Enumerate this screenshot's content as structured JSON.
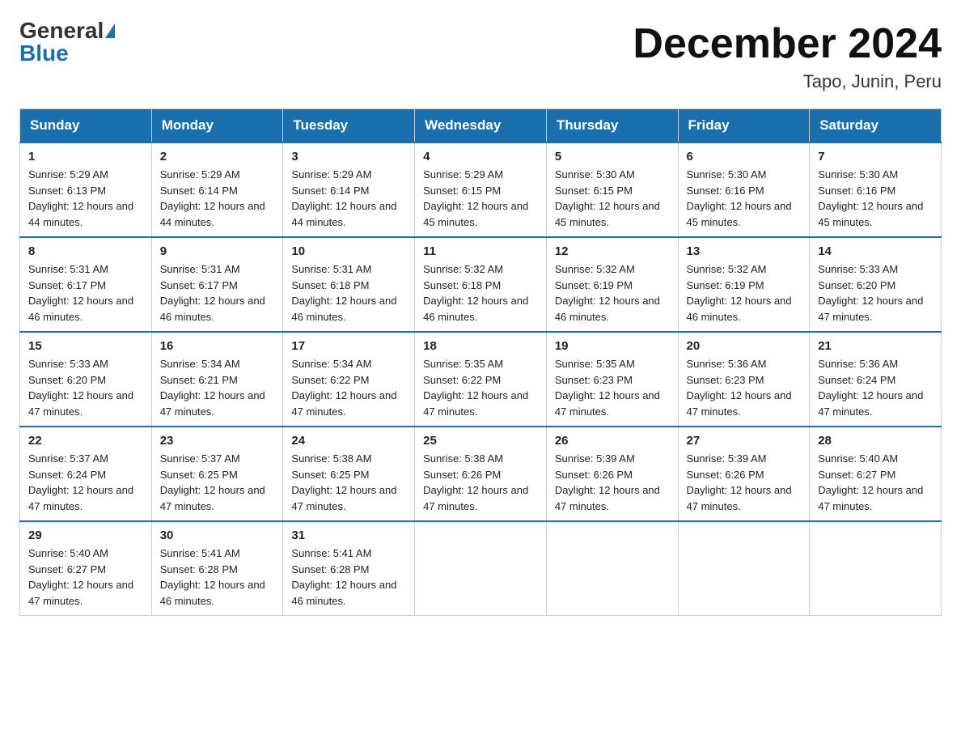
{
  "logo": {
    "general": "General",
    "blue": "Blue"
  },
  "title": "December 2024",
  "location": "Tapo, Junin, Peru",
  "headers": [
    "Sunday",
    "Monday",
    "Tuesday",
    "Wednesday",
    "Thursday",
    "Friday",
    "Saturday"
  ],
  "weeks": [
    [
      {
        "day": "1",
        "sunrise": "5:29 AM",
        "sunset": "6:13 PM",
        "daylight": "12 hours and 44 minutes."
      },
      {
        "day": "2",
        "sunrise": "5:29 AM",
        "sunset": "6:14 PM",
        "daylight": "12 hours and 44 minutes."
      },
      {
        "day": "3",
        "sunrise": "5:29 AM",
        "sunset": "6:14 PM",
        "daylight": "12 hours and 44 minutes."
      },
      {
        "day": "4",
        "sunrise": "5:29 AM",
        "sunset": "6:15 PM",
        "daylight": "12 hours and 45 minutes."
      },
      {
        "day": "5",
        "sunrise": "5:30 AM",
        "sunset": "6:15 PM",
        "daylight": "12 hours and 45 minutes."
      },
      {
        "day": "6",
        "sunrise": "5:30 AM",
        "sunset": "6:16 PM",
        "daylight": "12 hours and 45 minutes."
      },
      {
        "day": "7",
        "sunrise": "5:30 AM",
        "sunset": "6:16 PM",
        "daylight": "12 hours and 45 minutes."
      }
    ],
    [
      {
        "day": "8",
        "sunrise": "5:31 AM",
        "sunset": "6:17 PM",
        "daylight": "12 hours and 46 minutes."
      },
      {
        "day": "9",
        "sunrise": "5:31 AM",
        "sunset": "6:17 PM",
        "daylight": "12 hours and 46 minutes."
      },
      {
        "day": "10",
        "sunrise": "5:31 AM",
        "sunset": "6:18 PM",
        "daylight": "12 hours and 46 minutes."
      },
      {
        "day": "11",
        "sunrise": "5:32 AM",
        "sunset": "6:18 PM",
        "daylight": "12 hours and 46 minutes."
      },
      {
        "day": "12",
        "sunrise": "5:32 AM",
        "sunset": "6:19 PM",
        "daylight": "12 hours and 46 minutes."
      },
      {
        "day": "13",
        "sunrise": "5:32 AM",
        "sunset": "6:19 PM",
        "daylight": "12 hours and 46 minutes."
      },
      {
        "day": "14",
        "sunrise": "5:33 AM",
        "sunset": "6:20 PM",
        "daylight": "12 hours and 47 minutes."
      }
    ],
    [
      {
        "day": "15",
        "sunrise": "5:33 AM",
        "sunset": "6:20 PM",
        "daylight": "12 hours and 47 minutes."
      },
      {
        "day": "16",
        "sunrise": "5:34 AM",
        "sunset": "6:21 PM",
        "daylight": "12 hours and 47 minutes."
      },
      {
        "day": "17",
        "sunrise": "5:34 AM",
        "sunset": "6:22 PM",
        "daylight": "12 hours and 47 minutes."
      },
      {
        "day": "18",
        "sunrise": "5:35 AM",
        "sunset": "6:22 PM",
        "daylight": "12 hours and 47 minutes."
      },
      {
        "day": "19",
        "sunrise": "5:35 AM",
        "sunset": "6:23 PM",
        "daylight": "12 hours and 47 minutes."
      },
      {
        "day": "20",
        "sunrise": "5:36 AM",
        "sunset": "6:23 PM",
        "daylight": "12 hours and 47 minutes."
      },
      {
        "day": "21",
        "sunrise": "5:36 AM",
        "sunset": "6:24 PM",
        "daylight": "12 hours and 47 minutes."
      }
    ],
    [
      {
        "day": "22",
        "sunrise": "5:37 AM",
        "sunset": "6:24 PM",
        "daylight": "12 hours and 47 minutes."
      },
      {
        "day": "23",
        "sunrise": "5:37 AM",
        "sunset": "6:25 PM",
        "daylight": "12 hours and 47 minutes."
      },
      {
        "day": "24",
        "sunrise": "5:38 AM",
        "sunset": "6:25 PM",
        "daylight": "12 hours and 47 minutes."
      },
      {
        "day": "25",
        "sunrise": "5:38 AM",
        "sunset": "6:26 PM",
        "daylight": "12 hours and 47 minutes."
      },
      {
        "day": "26",
        "sunrise": "5:39 AM",
        "sunset": "6:26 PM",
        "daylight": "12 hours and 47 minutes."
      },
      {
        "day": "27",
        "sunrise": "5:39 AM",
        "sunset": "6:26 PM",
        "daylight": "12 hours and 47 minutes."
      },
      {
        "day": "28",
        "sunrise": "5:40 AM",
        "sunset": "6:27 PM",
        "daylight": "12 hours and 47 minutes."
      }
    ],
    [
      {
        "day": "29",
        "sunrise": "5:40 AM",
        "sunset": "6:27 PM",
        "daylight": "12 hours and 47 minutes."
      },
      {
        "day": "30",
        "sunrise": "5:41 AM",
        "sunset": "6:28 PM",
        "daylight": "12 hours and 46 minutes."
      },
      {
        "day": "31",
        "sunrise": "5:41 AM",
        "sunset": "6:28 PM",
        "daylight": "12 hours and 46 minutes."
      },
      null,
      null,
      null,
      null
    ]
  ]
}
